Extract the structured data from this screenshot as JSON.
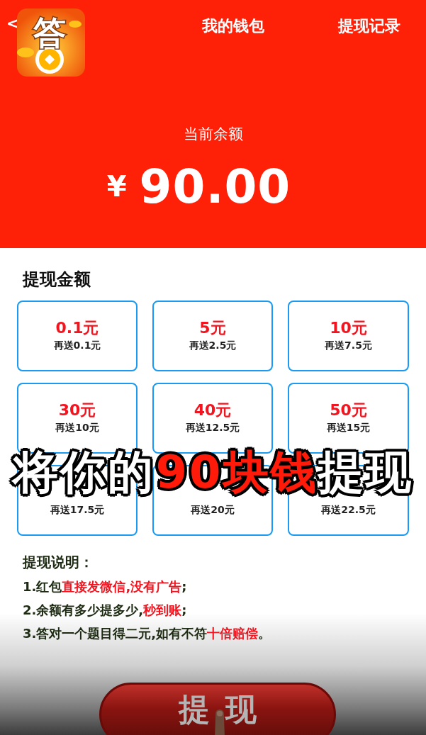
{
  "header": {
    "back": "<",
    "app_icon_label": "答",
    "title": "我的钱包",
    "action": "提现记录"
  },
  "balance": {
    "label": "当前余额",
    "currency": "¥",
    "amount": "90.00"
  },
  "withdraw": {
    "title": "提现金额",
    "options": [
      {
        "amount": "0.1元",
        "bonus": "再送0.1元"
      },
      {
        "amount": "5元",
        "bonus": "再送2.5元"
      },
      {
        "amount": "10元",
        "bonus": "再送7.5元"
      },
      {
        "amount": "30元",
        "bonus": "再送10元"
      },
      {
        "amount": "40元",
        "bonus": "再送12.5元"
      },
      {
        "amount": "50元",
        "bonus": "再送15元"
      },
      {
        "bonus": "再送17.5元"
      },
      {
        "bonus": "再送20元"
      },
      {
        "bonus": "再送22.5元"
      }
    ]
  },
  "notes": {
    "title": "提现说明：",
    "lines": [
      [
        {
          "text": "1.红包",
          "kind": "plain"
        },
        {
          "text": "直接发微信,没有广告",
          "kind": "highlight"
        },
        {
          "text": ";",
          "kind": "plain"
        }
      ],
      [
        {
          "text": "2.余额有多少提多少,",
          "kind": "plain"
        },
        {
          "text": "秒到账",
          "kind": "highlight"
        },
        {
          "text": ";",
          "kind": "plain"
        }
      ],
      [
        {
          "text": "3.答对一个题目得二元,如有不符",
          "kind": "plain"
        },
        {
          "text": "十倍赔偿",
          "kind": "highlight"
        },
        {
          "text": "。",
          "kind": "plain"
        }
      ]
    ]
  },
  "button": {
    "label": "提现"
  },
  "caption": [
    {
      "text": "将你的",
      "kind": "plain"
    },
    {
      "text": "90块钱",
      "kind": "highlight"
    },
    {
      "text": "提现",
      "kind": "plain"
    }
  ]
}
